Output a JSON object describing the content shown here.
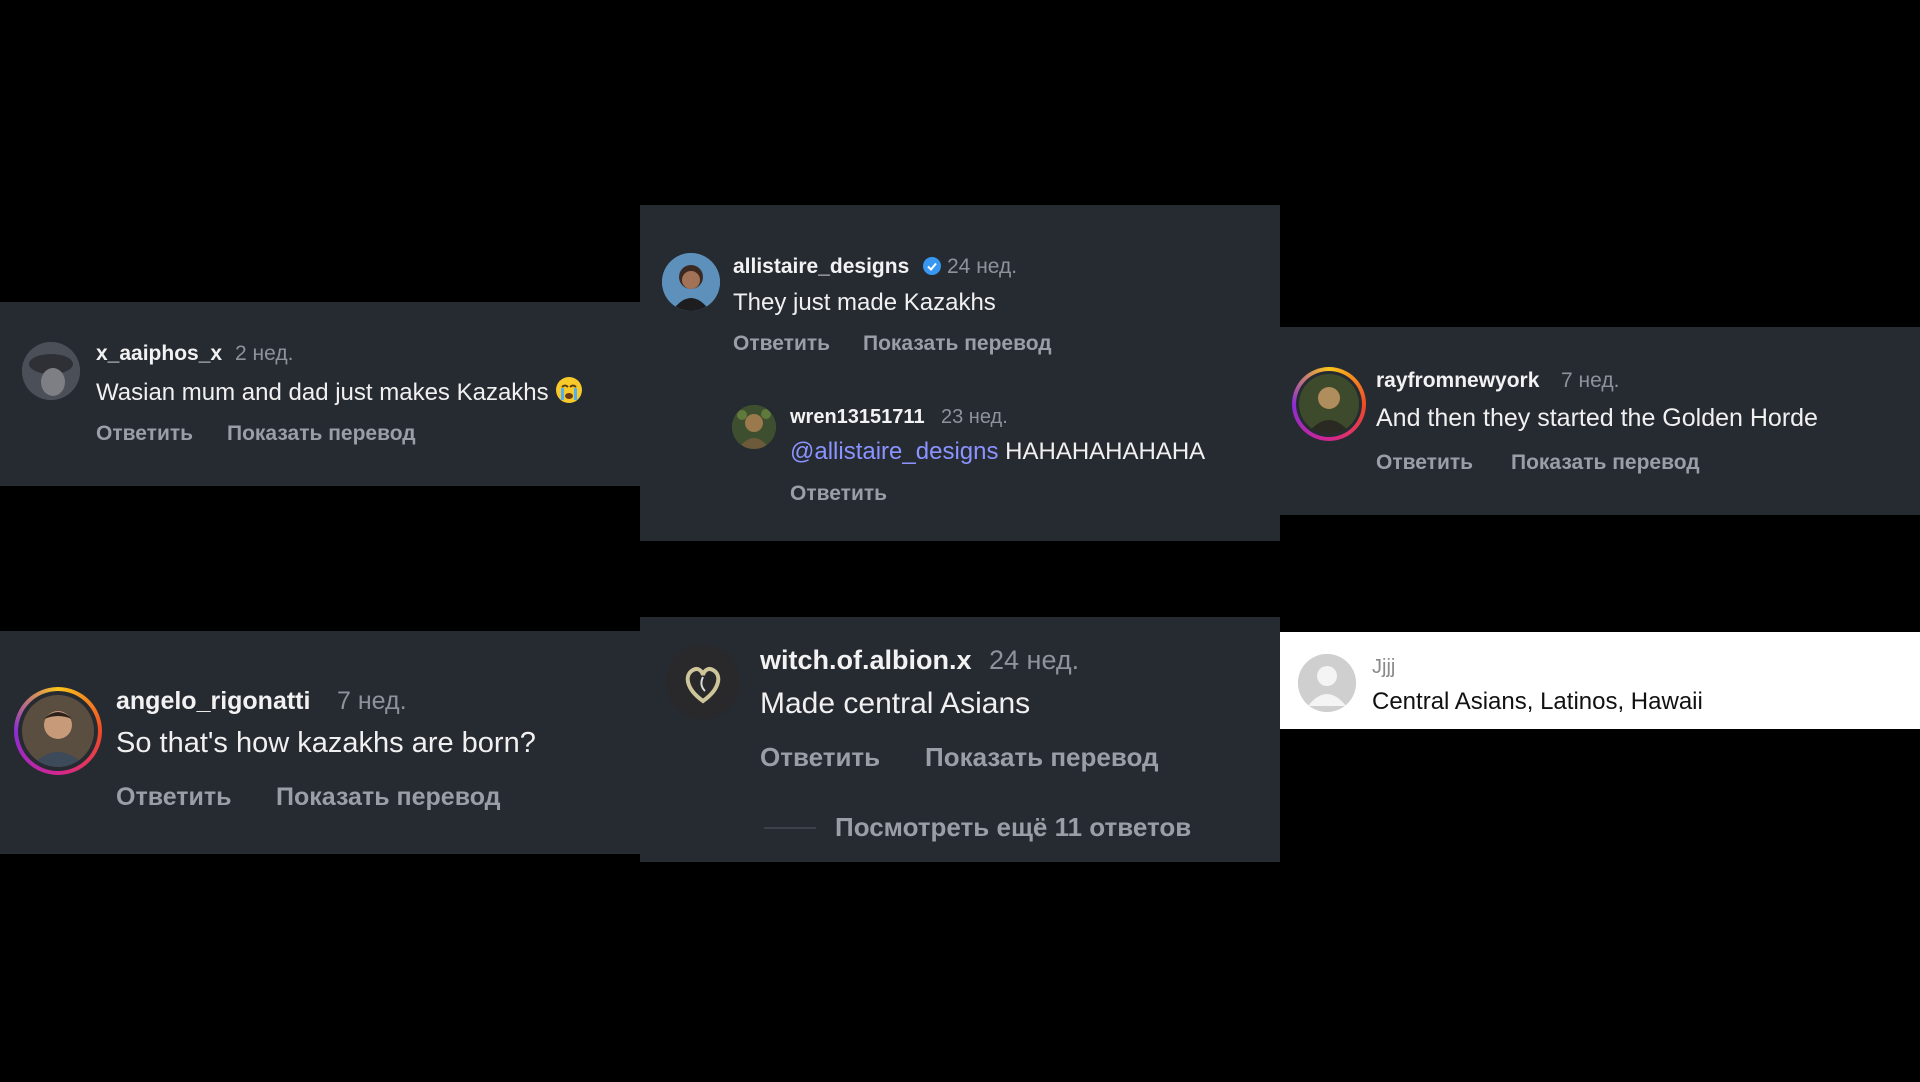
{
  "comments": [
    {
      "username": "x_aaiphos_x",
      "time": "2 нед.",
      "text": "Wasian mum and dad just makes Kazakhs",
      "emoji": "loudly-crying-face-icon",
      "reply_label": "Ответить",
      "translate_label": "Показать перевод"
    },
    {
      "username": "allistaire_designs",
      "verified": true,
      "time": "24 нед.",
      "text": "They just made Kazakhs",
      "reply_label": "Ответить",
      "translate_label": "Показать перевод",
      "reply": {
        "username": "wren13151711",
        "time": "23 нед.",
        "mention": "@allistaire_designs",
        "text": "HAHAHAHAHAHA",
        "reply_label": "Ответить"
      }
    },
    {
      "username": "rayfromnewyork",
      "time": "7 нед.",
      "text": "And then they started the Golden Horde",
      "reply_label": "Ответить",
      "translate_label": "Показать перевод"
    },
    {
      "username": "angelo_rigonatti",
      "time": "7 нед.",
      "text": "So that's how kazakhs are born?",
      "reply_label": "Ответить",
      "translate_label": "Показать перевод"
    },
    {
      "username": "witch.of.albion.x",
      "time": "24 нед.",
      "text": "Made central Asians",
      "reply_label": "Ответить",
      "translate_label": "Показать перевод",
      "more_replies": "Посмотреть ещё 11 ответов"
    },
    {
      "username": "Jjjj",
      "text": "Central Asians, Latinos, Hawaii"
    }
  ],
  "colors": {
    "panel_bg": "#262a31",
    "background": "#000000",
    "mention": "#8a93ff",
    "verified": "#3897f0",
    "muted": "#9a9fa7"
  }
}
